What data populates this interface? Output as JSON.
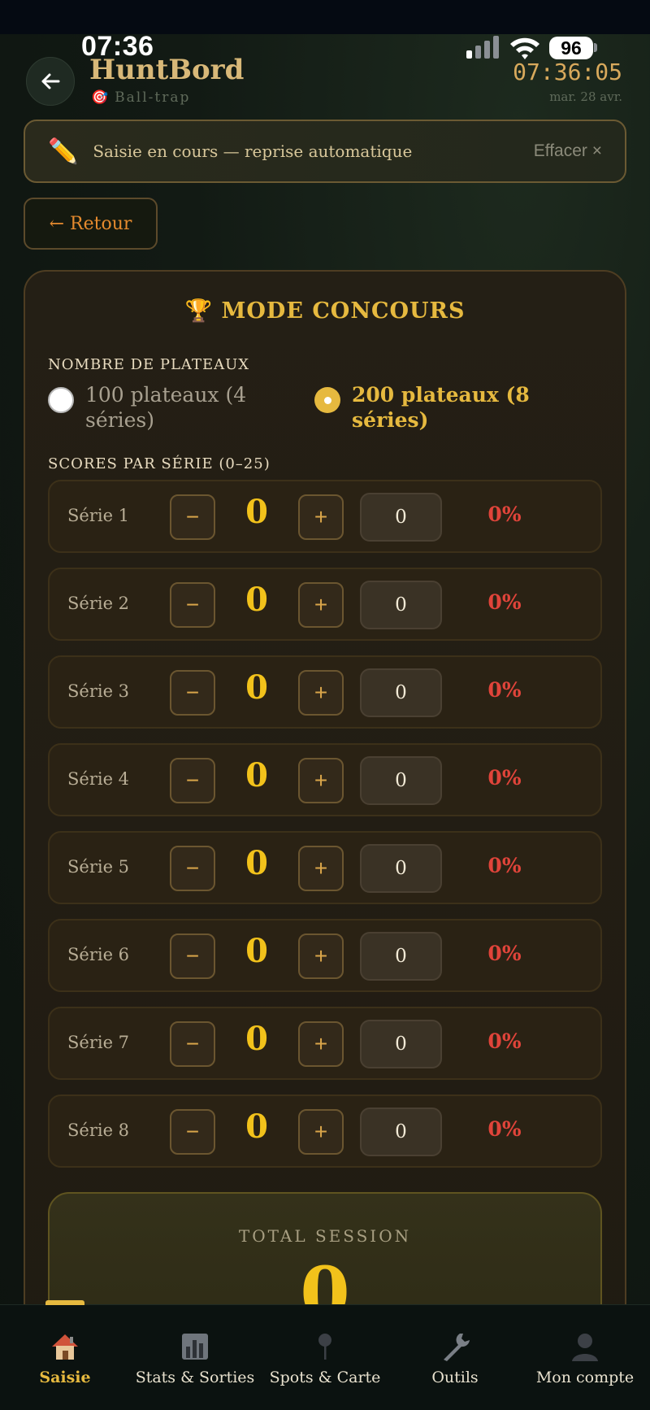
{
  "status_bar": {
    "time": "07:36",
    "battery": "96"
  },
  "header": {
    "title": "HuntBord",
    "subtitle": "Ball-trap",
    "subtitle_icon": "🎯",
    "clock": "07:36:05",
    "date": "mar. 28 avr."
  },
  "draft_banner": {
    "icon": "✏️",
    "message": "Saisie en cours — reprise automatique",
    "clear_label": "Effacer ×"
  },
  "retour_label": "← Retour",
  "mode": {
    "icon": "🏆",
    "title": "MODE CONCOURS",
    "plateaux_label": "NOMBRE DE PLATEAUX",
    "options": [
      {
        "label": "100 plateaux (4 séries)",
        "selected": false
      },
      {
        "label": "200 plateaux (8 séries)",
        "selected": true
      }
    ],
    "scores_label": "SCORES PAR SÉRIE (0–25)"
  },
  "series": [
    {
      "label": "Série 1",
      "value": "0",
      "input": "0",
      "percent": "0%"
    },
    {
      "label": "Série 2",
      "value": "0",
      "input": "0",
      "percent": "0%"
    },
    {
      "label": "Série 3",
      "value": "0",
      "input": "0",
      "percent": "0%"
    },
    {
      "label": "Série 4",
      "value": "0",
      "input": "0",
      "percent": "0%"
    },
    {
      "label": "Série 5",
      "value": "0",
      "input": "0",
      "percent": "0%"
    },
    {
      "label": "Série 6",
      "value": "0",
      "input": "0",
      "percent": "0%"
    },
    {
      "label": "Série 7",
      "value": "0",
      "input": "0",
      "percent": "0%"
    },
    {
      "label": "Série 8",
      "value": "0",
      "input": "0",
      "percent": "0%"
    }
  ],
  "controls": {
    "minus": "−",
    "plus": "+"
  },
  "total": {
    "label": "TOTAL SESSION",
    "value": "0"
  },
  "nav": [
    {
      "label": "Saisie",
      "icon": "house-icon",
      "active": true
    },
    {
      "label": "Stats & Sorties",
      "icon": "chart-icon",
      "active": false
    },
    {
      "label": "Spots & Carte",
      "icon": "pin-icon",
      "active": false
    },
    {
      "label": "Outils",
      "icon": "wrench-icon",
      "active": false
    },
    {
      "label": "Mon compte",
      "icon": "user-icon",
      "active": false
    }
  ],
  "colors": {
    "accent_gold": "#e6b93f",
    "score_yellow": "#f2c21b",
    "percent_red": "#e0443a",
    "retour_orange": "#e58a2e"
  }
}
